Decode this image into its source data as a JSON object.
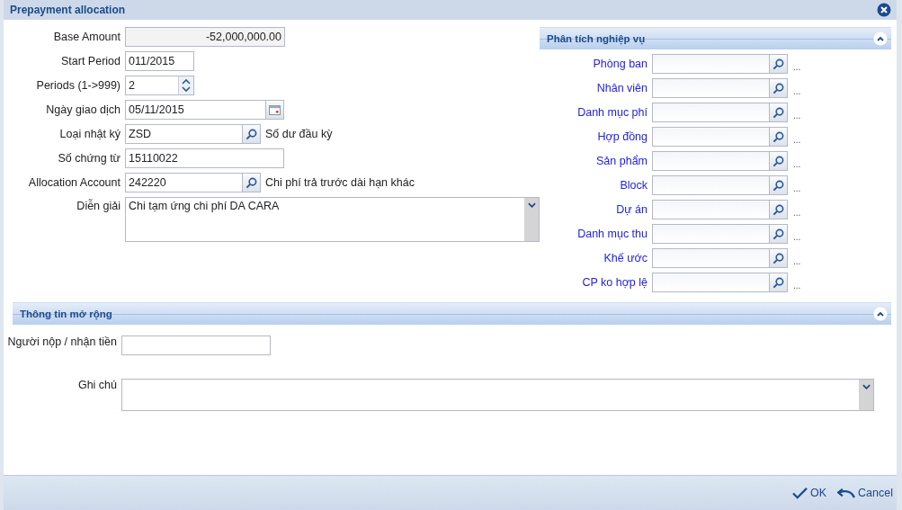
{
  "window": {
    "title": "Prepayment allocation"
  },
  "form": [
    {
      "kind": "readonly",
      "label": "Base Amount",
      "value": "-52,000,000.00"
    },
    {
      "kind": "short",
      "label": "Start Period",
      "value": "011/2015"
    },
    {
      "kind": "spinner",
      "label": "Periods (1->999)",
      "value": "2"
    },
    {
      "kind": "date",
      "label": "Ngày giao dịch",
      "value": "05/11/2015"
    },
    {
      "kind": "lookup",
      "label": "Loại nhật ký",
      "value": "ZSD",
      "description": "Số dư đầu kỳ"
    },
    {
      "kind": "text",
      "label": "Số chứng từ",
      "value": "15110022"
    },
    {
      "kind": "lookup",
      "label": "Allocation Account",
      "value": "242220",
      "description": "Chi phí trả trước dài hạn khác"
    },
    {
      "kind": "textarea",
      "label": "Diễn giải",
      "value": "Chi tạm ứng chi phí DA CARA"
    }
  ],
  "analysis": {
    "title": "Phân tích nghiệp vụ",
    "expanded": true,
    "rows": [
      {
        "label": "Phòng ban",
        "more": "..."
      },
      {
        "label": "Nhân viên",
        "more": "..."
      },
      {
        "label": "Danh mục phí",
        "more": "..."
      },
      {
        "label": "Hợp đồng",
        "more": "..."
      },
      {
        "label": "Sản phẩm",
        "more": "..."
      },
      {
        "label": "Block",
        "more": "..."
      },
      {
        "label": "Dự án",
        "more": "..."
      },
      {
        "label": "Danh mục thu",
        "more": "..."
      },
      {
        "label": "Khế ước",
        "more": "..."
      },
      {
        "label": "CP ko hợp lệ",
        "more": "..."
      }
    ]
  },
  "extended": {
    "title": "Thông tin mở rộng",
    "expanded": true,
    "fields": [
      {
        "kind": "short",
        "label": "Người nộp / nhận tiền"
      },
      {
        "kind": "textarea",
        "label": "Ghi chú"
      }
    ]
  },
  "buttons": [
    {
      "kind": "ok",
      "label": "OK"
    },
    {
      "kind": "cancel",
      "label": "Cancel"
    }
  ]
}
